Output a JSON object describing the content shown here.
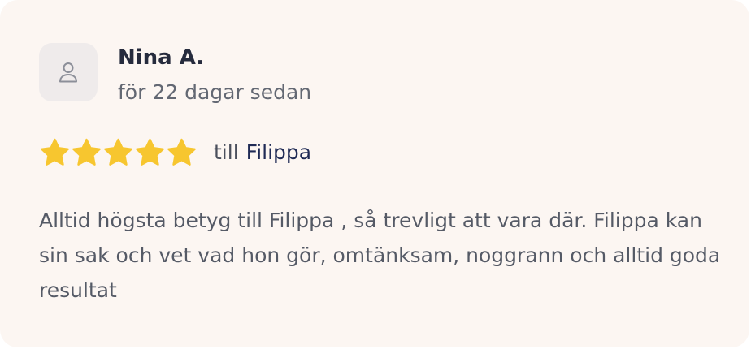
{
  "review": {
    "author": "Nina A.",
    "time_ago": "för 22 dagar sedan",
    "rating": 5,
    "rating_max": 5,
    "recipient_prefix": "till",
    "recipient_name": "Filippa",
    "text": "Alltid högsta betyg till Filippa , så trevligt att vara där. Filippa kan sin sak och vet vad hon gör, omtänksam, noggrann och alltid goda resultat"
  },
  "icons": {
    "avatar": "user-icon",
    "star": "star-icon"
  },
  "colors": {
    "card_background": "#fcf6f2",
    "avatar_background": "#efebeb",
    "star": "#f7c62f",
    "author": "#262b3d",
    "recipient": "#1f2a55"
  }
}
